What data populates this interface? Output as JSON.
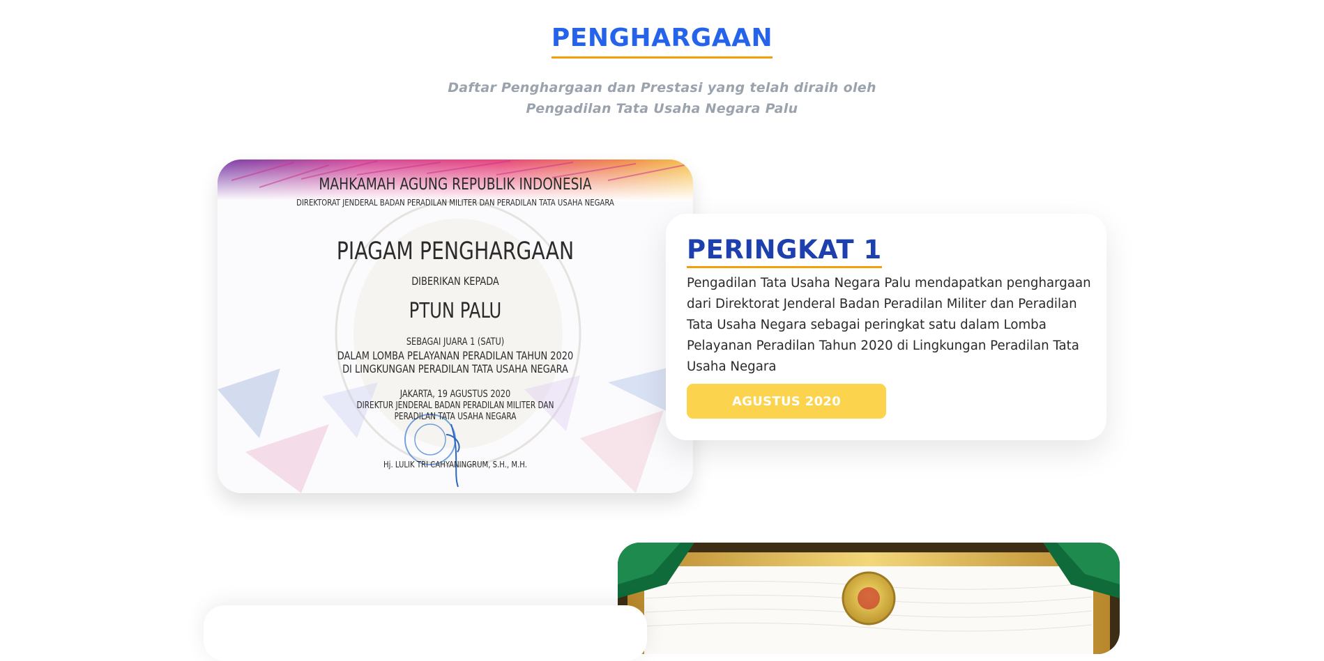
{
  "section": {
    "title": "PENGHARGAAN",
    "subtitle_line1": "Daftar Penghargaan dan Prestasi yang telah diraih oleh",
    "subtitle_line2": "Pengadilan Tata Usaha Negara Palu"
  },
  "colors": {
    "title_blue": "#2563eb",
    "heading_blue": "#1e40af",
    "underline_orange": "#f59e0b",
    "button_yellow": "#fcd34d",
    "subtitle_gray": "#9aa3ad"
  },
  "awards": [
    {
      "certificate": {
        "org": "MAHKAMAH AGUNG REPUBLIK INDONESIA",
        "directorate": "DIREKTORAT JENDERAL BADAN PERADILAN MILITER DAN PERADILAN TATA USAHA NEGARA",
        "title": "PIAGAM PENGHARGAAN",
        "given_to": "DIBERIKAN KEPADA",
        "recipient": "PTUN PALU",
        "line1": "SEBAGAI JUARA 1 (SATU)",
        "line2": "DALAM LOMBA PELAYANAN PERADILAN TAHUN 2020",
        "line3": "DI LINGKUNGAN PERADILAN TATA USAHA NEGARA",
        "place_date": "JAKARTA, 19 AGUSTUS 2020",
        "signer_title1": "DIREKTUR JENDERAL BADAN PERADILAN MILITER DAN",
        "signer_title2": "PERADILAN TATA USAHA NEGARA",
        "signer_name": "Hj. LULIK TRI CAHYANINGRUM, S.H., M.H."
      },
      "heading": "PERINGKAT 1",
      "description": "Pengadilan Tata Usaha Negara Palu mendapatkan penghargaan dari Direktorat Jenderal Badan Peradilan Militer dan Peradilan Tata Usaha Negara sebagai peringkat satu dalam Lomba Pelayanan Peradilan Tahun 2020 di Lingkungan Peradilan Tata Usaha Negara",
      "date_label": "AGUSTUS 2020"
    }
  ]
}
